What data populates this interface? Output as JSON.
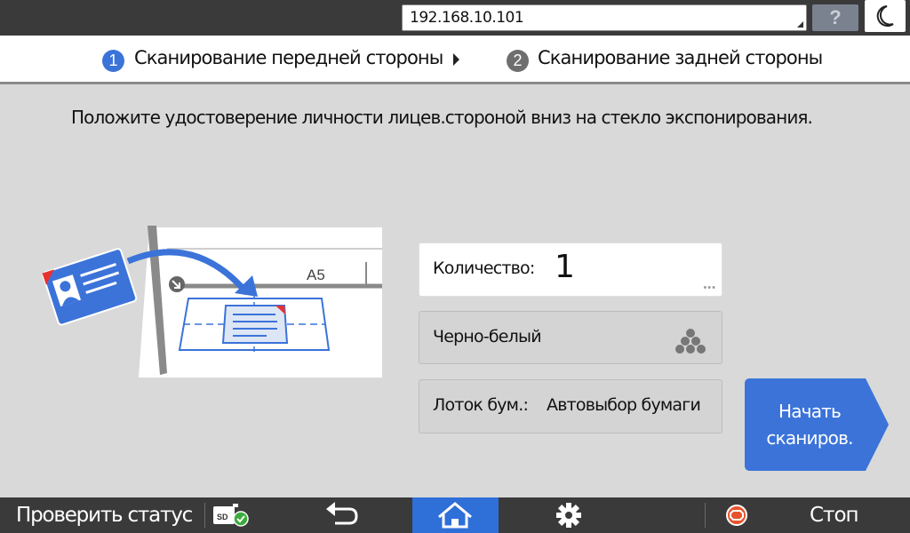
{
  "topbar": {
    "address": "192.168.10.101",
    "help_label": "?"
  },
  "steps": {
    "step1": {
      "number": "1",
      "label": "Сканирование передней стороны"
    },
    "step2": {
      "number": "2",
      "label": "Сканирование задней стороны"
    }
  },
  "instruction": "Положите удостоверение личности лицев.стороной вниз на стекло экспонирования.",
  "illustration": {
    "paper_size": "A5"
  },
  "settings": {
    "quantity_label": "Количество:",
    "quantity_value": "1",
    "color_mode": "Черно-белый",
    "tray_label": "Лоток бум.:",
    "tray_value": "Автовыбор бумаги"
  },
  "start_button": {
    "line1": "Начать",
    "line2": "сканиров."
  },
  "bottombar": {
    "status_label": "Проверить статус",
    "stop_label": "Стоп"
  },
  "colors": {
    "accent_blue": "#3b73d9",
    "home_active": "#2f6fd8",
    "stop_orange": "#e8532b",
    "bar_dark": "#3a3a3a"
  }
}
